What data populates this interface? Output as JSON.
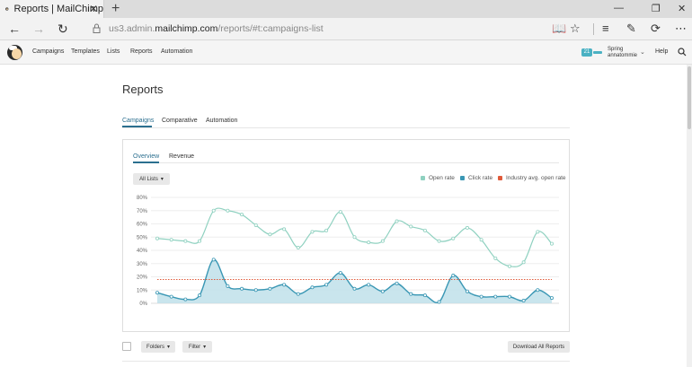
{
  "browser": {
    "tab_title": "Reports | MailChimp",
    "url_prefix": "us3.admin.",
    "url_domain": "mailchimp.com",
    "url_path": "/reports/#t:campaigns-list"
  },
  "nav": {
    "items": [
      "Campaigns",
      "Templates",
      "Lists",
      "Reports",
      "Automation"
    ],
    "badge": "21",
    "user_line1": "Spring",
    "user_line2": "annatommie",
    "help": "Help"
  },
  "page": {
    "title": "Reports",
    "tabs": [
      "Campaigns",
      "Comparative",
      "Automation"
    ],
    "active_tab": "Campaigns"
  },
  "panel": {
    "tabs": [
      "Overview",
      "Revenue"
    ],
    "list_filter": "All Lists",
    "legend": [
      {
        "label": "Open rate",
        "color": "#8fd1c0"
      },
      {
        "label": "Click rate",
        "color": "#3a97b4"
      },
      {
        "label": "Industry avg. open rate",
        "color": "#e05a3a"
      }
    ]
  },
  "chart_data": {
    "type": "area",
    "ytick_labels": [
      "80%",
      "70%",
      "60%",
      "50%",
      "40%",
      "30%",
      "20%",
      "10%",
      "0%"
    ],
    "ylim": [
      0,
      80
    ],
    "grid": true,
    "legend_position": "top-right",
    "series": [
      {
        "name": "Open rate",
        "color": "#8fd1c0",
        "values": [
          49,
          48,
          47,
          47,
          70,
          70,
          67,
          59,
          52,
          56,
          42,
          54,
          55,
          69,
          50,
          46,
          47,
          62,
          58,
          55,
          47,
          49,
          57,
          48,
          34,
          28,
          31,
          54,
          45
        ]
      },
      {
        "name": "Click rate",
        "color": "#3a97b4",
        "values": [
          8,
          5,
          3,
          6,
          33,
          13,
          11,
          10,
          11,
          14,
          7,
          12,
          14,
          23,
          11,
          14,
          9,
          15,
          7,
          6,
          1,
          21,
          9,
          5,
          5,
          5,
          2,
          10,
          4
        ]
      },
      {
        "name": "Industry avg. open rate",
        "color": "#e05a3a",
        "values": [
          18,
          18
        ]
      }
    ]
  },
  "toolbar": {
    "folders": "Folders",
    "filter": "Filter",
    "download": "Download All Reports"
  }
}
